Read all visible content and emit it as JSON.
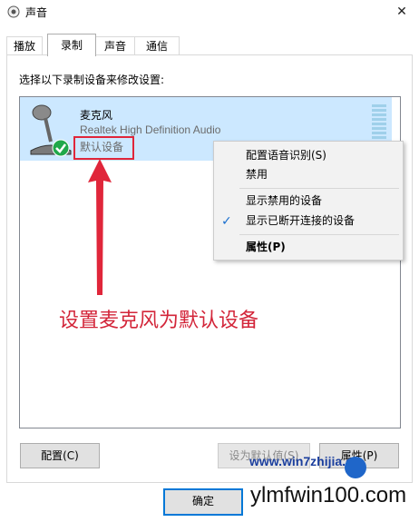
{
  "window": {
    "title": "声音",
    "close_glyph": "✕"
  },
  "tabs": [
    {
      "label": "播放"
    },
    {
      "label": "录制"
    },
    {
      "label": "声音"
    },
    {
      "label": "通信"
    }
  ],
  "instruction": "选择以下录制设备来修改设置:",
  "device": {
    "name": "麦克风",
    "description": "Realtek High Definition Audio",
    "status": "默认设备",
    "icon": "microphone-icon"
  },
  "context_menu": {
    "items": [
      {
        "label": "配置语音识别(S)"
      },
      {
        "label": "禁用"
      },
      {
        "label": "显示禁用的设备"
      },
      {
        "label": "显示已断开连接的设备",
        "checked": true
      },
      {
        "label": "属性(P)",
        "bold": true
      }
    ]
  },
  "annotation": "设置麦克风为默认设备",
  "buttons": {
    "configure": "配置(C)",
    "set_default": "设为默认值(S)",
    "properties": "属性(P)",
    "ok": "确定"
  },
  "watermark": {
    "site1": "www.win7zhijia.cn",
    "site2": "ylmfwin100.com"
  },
  "colors": {
    "selection": "#cce8ff",
    "highlight_red": "#e0263a",
    "accent": "#0078d7"
  }
}
